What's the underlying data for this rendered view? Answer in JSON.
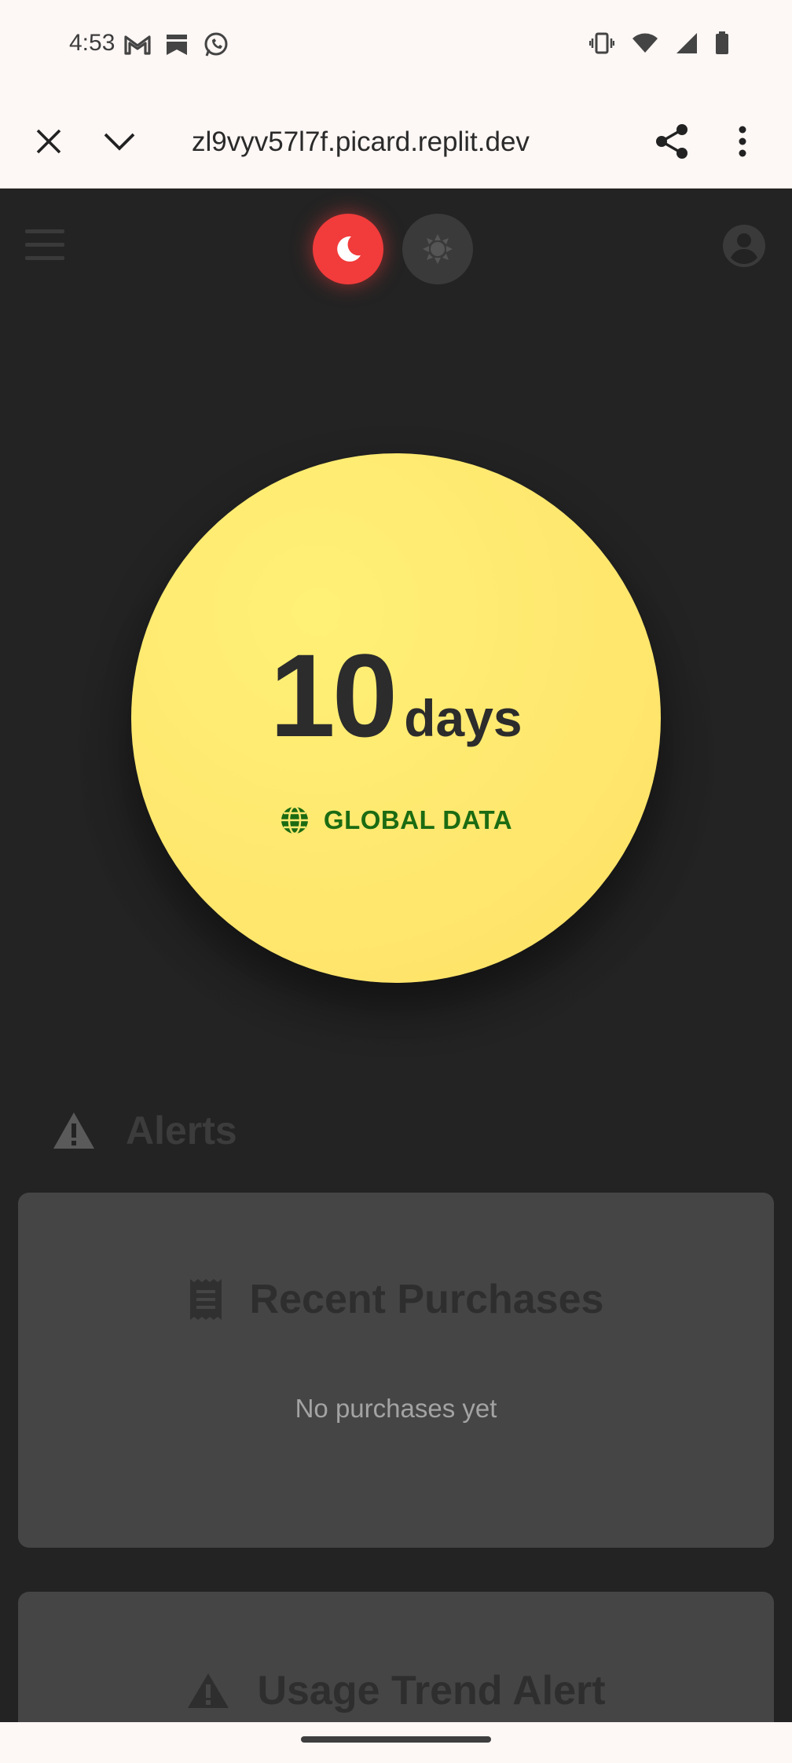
{
  "status_bar": {
    "time": "4:53",
    "left_icons": [
      "gmail-icon",
      "bookmark-icon",
      "whatsapp-icon"
    ],
    "right_icons": [
      "vibrate-icon",
      "wifi-icon",
      "signal-icon",
      "battery-icon"
    ]
  },
  "browser": {
    "url": "zl9vyv57l7f.picard.replit.dev"
  },
  "app": {
    "theme_toggle": {
      "dark_selected": true,
      "accent": "#f23b3b"
    },
    "counter": {
      "value": "10",
      "unit": "days",
      "source_label": "GLOBAL DATA",
      "circle_color": "#ffe970",
      "source_color": "#1b6b12"
    },
    "alerts": {
      "title": "Alerts"
    },
    "cards": {
      "purchases": {
        "title": "Recent Purchases",
        "empty_text": "No purchases yet"
      },
      "trend": {
        "title": "Usage Trend Alert"
      }
    }
  }
}
